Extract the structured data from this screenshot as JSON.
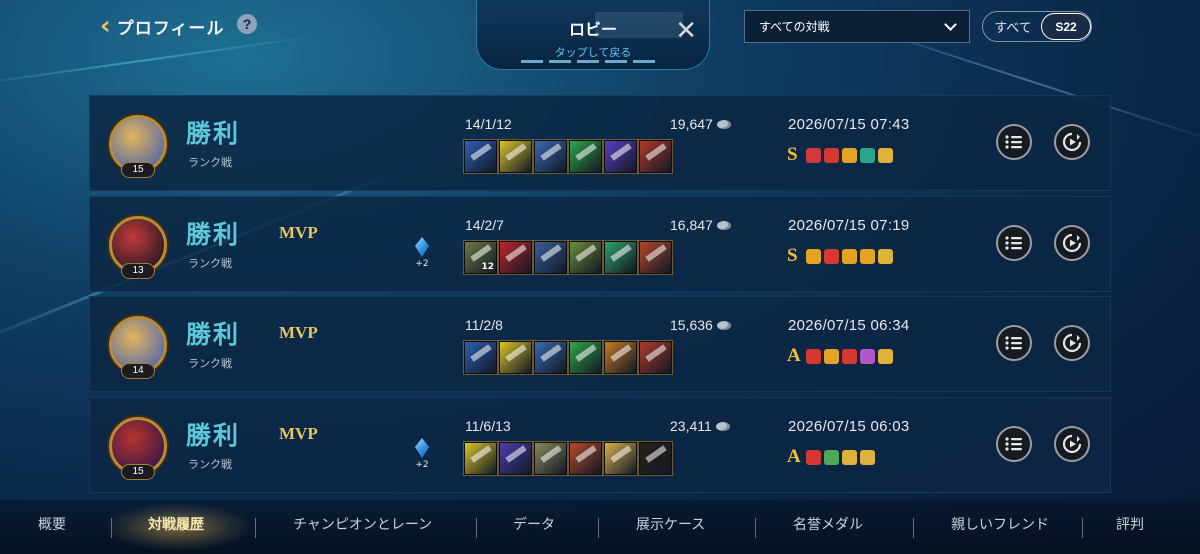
{
  "header": {
    "back_title": "プロフィール",
    "help_symbol": "?",
    "lobby": {
      "title": "ロビー",
      "subtitle": "タップして戻る",
      "close_symbol": "✕"
    },
    "filter": {
      "selected": "すべての対戦"
    },
    "season": {
      "all_label": "すべて",
      "current_label": "S22"
    }
  },
  "matches": [
    {
      "level": "15",
      "result": "勝利",
      "mode": "ランク戦",
      "mvp": "",
      "crystal_bonus": "",
      "kda": "14/1/12",
      "gold": "19,647",
      "date": "2026/07/15 07:43",
      "grade": "S",
      "portrait_colors": [
        "#e2b55a",
        "#5a6aa8"
      ],
      "item_colors": [
        "#2e5fb5",
        "#d8c52a",
        "#3b6ab0",
        "#2ea84a",
        "#5a3fc0",
        "#b23a2a"
      ],
      "item_counts": [
        "",
        "",
        "",
        "",
        "",
        ""
      ],
      "medal_colors": [
        "#d03a3a",
        "#d6382f",
        "#e3a323",
        "#2ca58c",
        "#e1b23a"
      ]
    },
    {
      "level": "13",
      "result": "勝利",
      "mode": "ランク戦",
      "mvp": "MVP",
      "crystal_bonus": "+2",
      "kda": "14/2/7",
      "gold": "16,847",
      "date": "2026/07/15 07:19",
      "grade": "S",
      "portrait_colors": [
        "#c23a3a",
        "#2a1a22"
      ],
      "item_colors": [
        "#6d7a44",
        "#c0262a",
        "#3a5f9a",
        "#6b8f3a",
        "#2f9f6a",
        "#b3472a"
      ],
      "item_counts": [
        "12",
        "",
        "",
        "",
        "",
        ""
      ],
      "medal_colors": [
        "#e3a323",
        "#d6382f",
        "#e3a323",
        "#e3a323",
        "#e1b23a"
      ]
    },
    {
      "level": "14",
      "result": "勝利",
      "mode": "ランク戦",
      "mvp": "MVP",
      "crystal_bonus": "",
      "kda": "11/2/8",
      "gold": "15,636",
      "date": "2026/07/15 06:34",
      "grade": "A",
      "portrait_colors": [
        "#e2b55a",
        "#5a6aa8"
      ],
      "item_colors": [
        "#2e5fb5",
        "#d8c52a",
        "#3b6ab0",
        "#2ea84a",
        "#c87a22",
        "#b23a2a"
      ],
      "item_counts": [
        "",
        "",
        "",
        "",
        "",
        ""
      ],
      "medal_colors": [
        "#d6382f",
        "#e3a323",
        "#d6382f",
        "#b057c8",
        "#e1b23a"
      ]
    },
    {
      "level": "15",
      "result": "勝利",
      "mode": "ランク戦",
      "mvp": "MVP",
      "crystal_bonus": "+2",
      "kda": "11/6/13",
      "gold": "23,411",
      "date": "2026/07/15 06:03",
      "grade": "A",
      "portrait_colors": [
        "#b8332e",
        "#3a1a44"
      ],
      "item_colors": [
        "#d8c52a",
        "#4a3fb0",
        "#8a8a5a",
        "#b54a2a",
        "#d9b04a",
        "#2a2218"
      ],
      "item_counts": [
        "",
        "",
        "",
        "",
        "",
        ""
      ],
      "medal_colors": [
        "#d6382f",
        "#4fa85a",
        "#e1b23a",
        "#e1b23a"
      ]
    }
  ],
  "nav": {
    "tabs": [
      "概要",
      "対戦履歴",
      "チャンピオンとレーン",
      "データ",
      "展示ケース",
      "名誉メダル",
      "親しいフレンド",
      "評判"
    ],
    "active_index": 1
  },
  "colors": {
    "accent_gold": "#e7c55f",
    "victory_teal": "#5cc7d9",
    "lobby_hint": "#5ec6f0"
  }
}
